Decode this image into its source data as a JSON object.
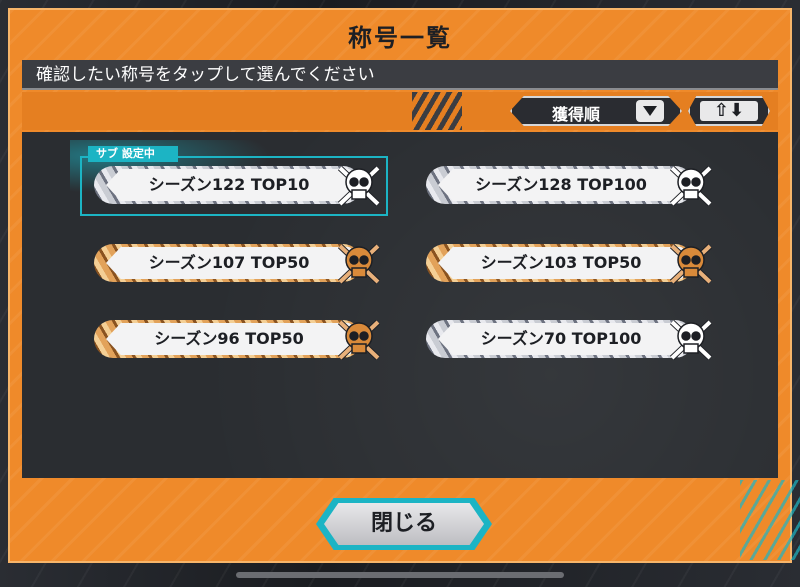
{
  "window": {
    "title": "称号一覧",
    "instruction": "確認したい称号をタップして選んでください"
  },
  "toolbar": {
    "sort_label": "獲得順",
    "sort_icon": "chevron-down-icon",
    "order_label": "⇧⬇",
    "order_icon": "sort-order-icon"
  },
  "titles": [
    {
      "label": "シーズン122 TOP10",
      "rope": "silver",
      "skull": "silver",
      "badge": "サブ 設定中",
      "selected": true
    },
    {
      "label": "シーズン128 TOP100",
      "rope": "silver",
      "skull": "silver"
    },
    {
      "label": "シーズン107 TOP50",
      "rope": "gold",
      "skull": "gold"
    },
    {
      "label": "シーズン103 TOP50",
      "rope": "gold",
      "skull": "gold"
    },
    {
      "label": "シーズン96 TOP50",
      "rope": "gold",
      "skull": "gold"
    },
    {
      "label": "シーズン70 TOP100",
      "rope": "silver",
      "skull": "silver"
    }
  ],
  "footer": {
    "close_label": "閉じる"
  },
  "colors": {
    "frame_orange": "#ef8a2a",
    "panel_dark": "#2a2d31",
    "accent_cyan": "#1cb4c4",
    "gold_skull": "#d98a3a",
    "silver_skull": "#ffffff"
  }
}
